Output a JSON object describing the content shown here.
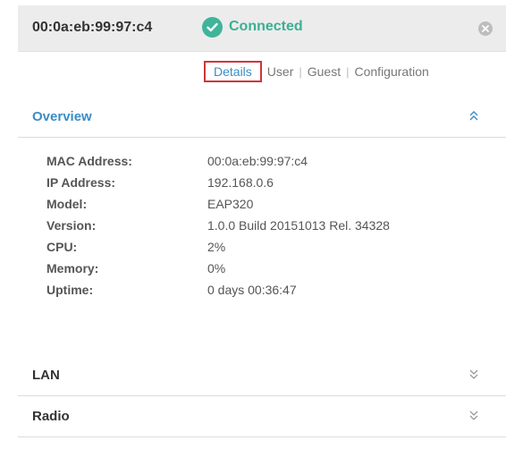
{
  "header": {
    "mac": "00:0a:eb:99:97:c4",
    "status": "Connected"
  },
  "tabs": [
    {
      "label": "Details",
      "active": true
    },
    {
      "label": "User",
      "active": false
    },
    {
      "label": "Guest",
      "active": false
    },
    {
      "label": "Configuration",
      "active": false
    }
  ],
  "overview": {
    "title": "Overview",
    "rows": [
      {
        "label": "MAC Address:",
        "value": "00:0a:eb:99:97:c4"
      },
      {
        "label": "IP Address:",
        "value": "192.168.0.6"
      },
      {
        "label": "Model:",
        "value": "EAP320"
      },
      {
        "label": "Version:",
        "value": "1.0.0 Build 20151013 Rel. 34328"
      },
      {
        "label": "CPU:",
        "value": "2%"
      },
      {
        "label": "Memory:",
        "value": "0%"
      },
      {
        "label": "Uptime:",
        "value": "0 days 00:36:47"
      }
    ]
  },
  "sections": {
    "lan": "LAN",
    "radio": "Radio"
  },
  "colors": {
    "accent": "#3a8cc4",
    "connected": "#3ab094",
    "highlight_border": "#d0343a"
  }
}
